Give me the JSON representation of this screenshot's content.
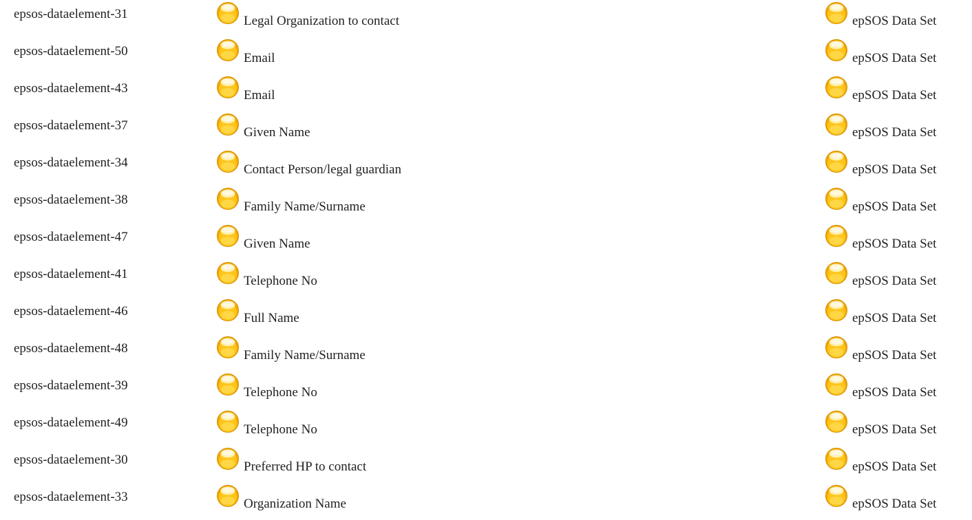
{
  "icon": "yellow-orb-icon",
  "accent_color": "#f5b400",
  "rows": [
    {
      "id": "epsos-dataelement-31",
      "name": "Legal Organization to contact",
      "dataset": "epSOS Data Set"
    },
    {
      "id": "epsos-dataelement-50",
      "name": "Email",
      "dataset": "epSOS Data Set"
    },
    {
      "id": "epsos-dataelement-43",
      "name": "Email",
      "dataset": "epSOS Data Set"
    },
    {
      "id": "epsos-dataelement-37",
      "name": "Given Name",
      "dataset": "epSOS Data Set"
    },
    {
      "id": "epsos-dataelement-34",
      "name": "Contact Person/legal guardian",
      "dataset": "epSOS Data Set"
    },
    {
      "id": "epsos-dataelement-38",
      "name": "Family Name/Surname",
      "dataset": "epSOS Data Set"
    },
    {
      "id": "epsos-dataelement-47",
      "name": "Given Name",
      "dataset": "epSOS Data Set"
    },
    {
      "id": "epsos-dataelement-41",
      "name": "Telephone No",
      "dataset": "epSOS Data Set"
    },
    {
      "id": "epsos-dataelement-46",
      "name": "Full Name",
      "dataset": "epSOS Data Set"
    },
    {
      "id": "epsos-dataelement-48",
      "name": "Family Name/Surname",
      "dataset": "epSOS Data Set"
    },
    {
      "id": "epsos-dataelement-39",
      "name": "Telephone No",
      "dataset": "epSOS Data Set"
    },
    {
      "id": "epsos-dataelement-49",
      "name": "Telephone No",
      "dataset": "epSOS Data Set"
    },
    {
      "id": "epsos-dataelement-30",
      "name": "Preferred HP to contact",
      "dataset": "epSOS Data Set"
    },
    {
      "id": "epsos-dataelement-33",
      "name": "Organization Name",
      "dataset": "epSOS Data Set"
    }
  ]
}
